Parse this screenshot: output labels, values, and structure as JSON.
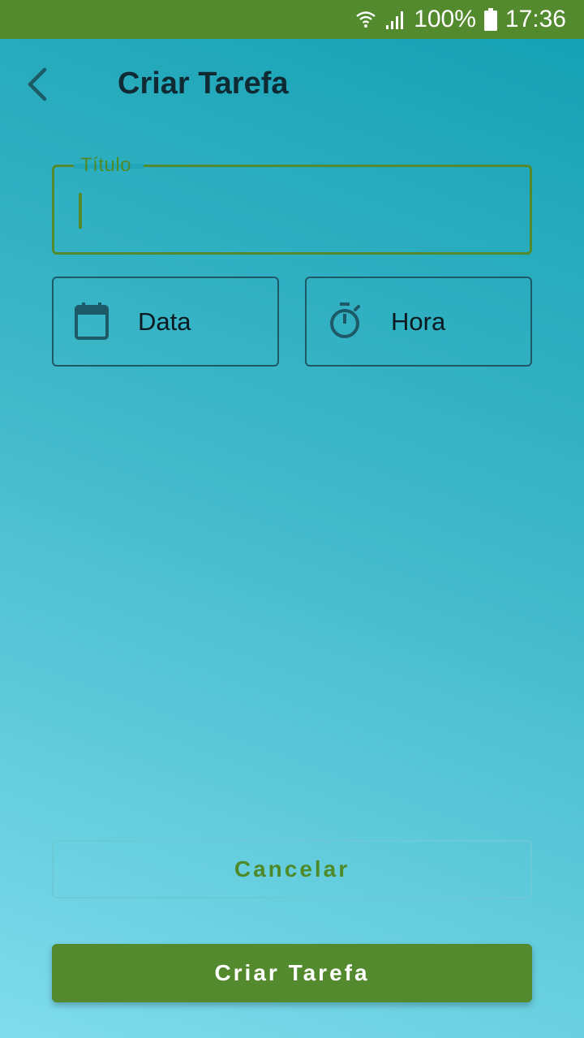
{
  "status_bar": {
    "battery": "100%",
    "time": "17:36",
    "icons": [
      "wifi-icon",
      "signal-icon",
      "battery-icon"
    ]
  },
  "app_bar": {
    "title": "Criar Tarefa",
    "back_icon": "chevron-left-icon"
  },
  "form": {
    "title_field": {
      "label": "Título",
      "value": "",
      "placeholder": ""
    },
    "date_button": {
      "label": "Data",
      "icon": "calendar-icon"
    },
    "time_button": {
      "label": "Hora",
      "icon": "stopwatch-icon"
    }
  },
  "actions": {
    "cancel_label": "Cancelar",
    "create_label": "Criar Tarefa"
  },
  "colors": {
    "primary_green": "#548a2e",
    "icon_dark_teal": "#1d5a68",
    "background_top": "#13a0b3",
    "background_bottom": "#7fdcec"
  }
}
